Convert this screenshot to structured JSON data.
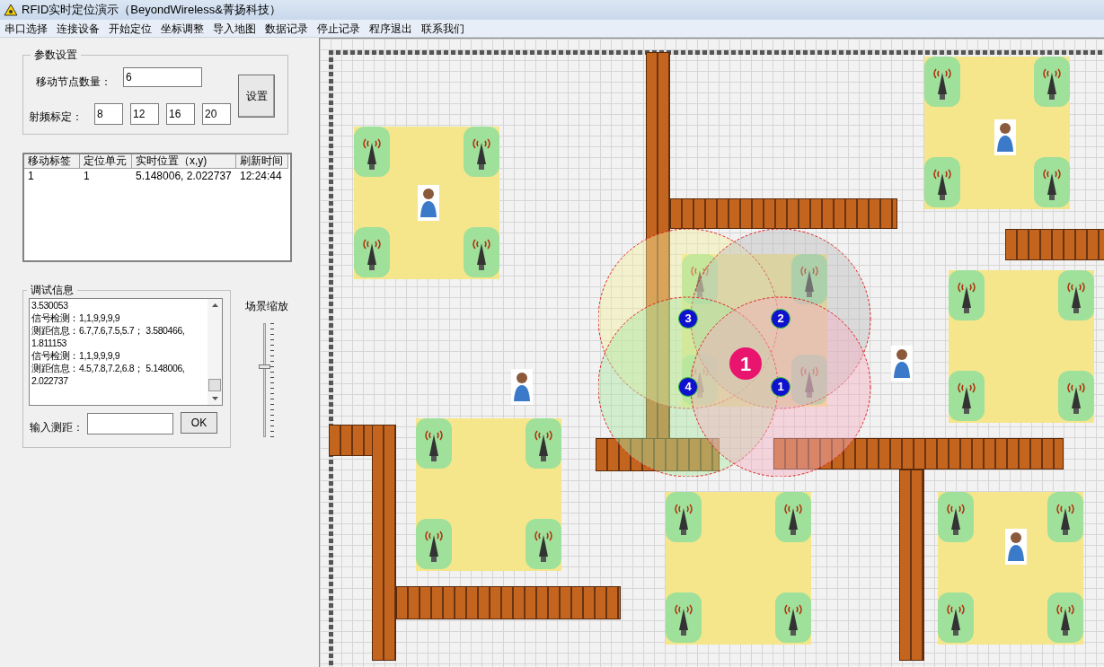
{
  "window": {
    "title": "RFID实时定位演示（BeyondWireless&菁扬科技）"
  },
  "menu": [
    "串口选择",
    "连接设备",
    "开始定位",
    "坐标调整",
    "导入地图",
    "数据记录",
    "停止记录",
    "程序退出",
    "联系我们"
  ],
  "params": {
    "legend": "参数设置",
    "node_count_label": "移动节点数量：",
    "node_count": "6",
    "rf_label": "射频标定：",
    "rf_values": [
      "8",
      "12",
      "16",
      "20"
    ],
    "set_button": "设置"
  },
  "table": {
    "columns": [
      "移动标签",
      "定位单元",
      "实时位置（x,y)",
      "刷新时间"
    ],
    "rows": [
      [
        "1",
        "1",
        "5.148006, 2.022737",
        "12:24:44"
      ]
    ]
  },
  "debug": {
    "legend": "调试信息",
    "lines": [
      "3.530053",
      "信号检测：1,1,9,9,9,9",
      "测距信息：6.7,7.6,7.5,5.7；  3.580466,",
      "1.811153",
      "信号检测：1,1,9,9,9,9",
      "测距信息：4.5,7.8,7.2,6.8；  5.148006,",
      "2.022737"
    ],
    "input_label": "输入测距：",
    "ok_button": "OK"
  },
  "zoom": {
    "label": "场景缩放",
    "level": 0.62
  },
  "map": {
    "anchors": [
      {
        "label": "3"
      },
      {
        "label": "2"
      },
      {
        "label": "4"
      },
      {
        "label": "1"
      }
    ],
    "tag": {
      "label": "1"
    }
  }
}
